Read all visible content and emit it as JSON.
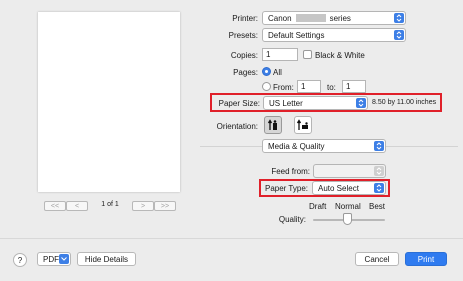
{
  "preview": {
    "prev_first": "<<",
    "prev": "<",
    "page_count": "1 of 1",
    "next": ">",
    "next_last": ">>"
  },
  "printer": {
    "label": "Printer:",
    "value_prefix": "Canon",
    "value_suffix": "series"
  },
  "presets": {
    "label": "Presets:",
    "value": "Default Settings"
  },
  "copies": {
    "label": "Copies:",
    "value": "1",
    "bw_label": "Black & White"
  },
  "pages": {
    "label": "Pages:",
    "all_label": "All",
    "from_label": "From:",
    "from_value": "1",
    "to_label": "to:",
    "to_value": "1"
  },
  "paper_size": {
    "label": "Paper Size:",
    "value": "US Letter",
    "dimensions": "8.50 by 11.00 inches"
  },
  "orientation": {
    "label": "Orientation:"
  },
  "section": {
    "value": "Media & Quality"
  },
  "feed_from": {
    "label": "Feed from:",
    "value": ""
  },
  "paper_type": {
    "label": "Paper Type:",
    "value": "Auto Select"
  },
  "quality": {
    "label": "Quality:",
    "draft": "Draft",
    "normal": "Normal",
    "best": "Best",
    "level": 0.5
  },
  "footer": {
    "help": "?",
    "pdf": "PDF",
    "hide_details": "Hide Details",
    "cancel": "Cancel",
    "print": "Print"
  },
  "colors": {
    "accent": "#2f7bf0",
    "highlight_border": "#e0202a"
  }
}
